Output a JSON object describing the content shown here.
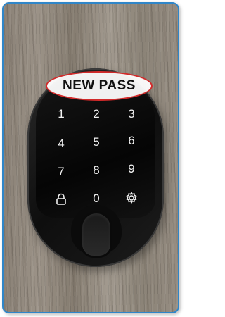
{
  "banner": {
    "label": "NEW PASS"
  },
  "keypad": {
    "keys": [
      "1",
      "2",
      "3",
      "4",
      "5",
      "6",
      "7",
      "8",
      "9",
      "lock",
      "0",
      "settings"
    ]
  },
  "colors": {
    "frame_border": "#2f86c9",
    "highlight_ring": "#d22a2a"
  },
  "icons": {
    "lock_key": "lock-icon",
    "settings_key": "gear-icon"
  }
}
